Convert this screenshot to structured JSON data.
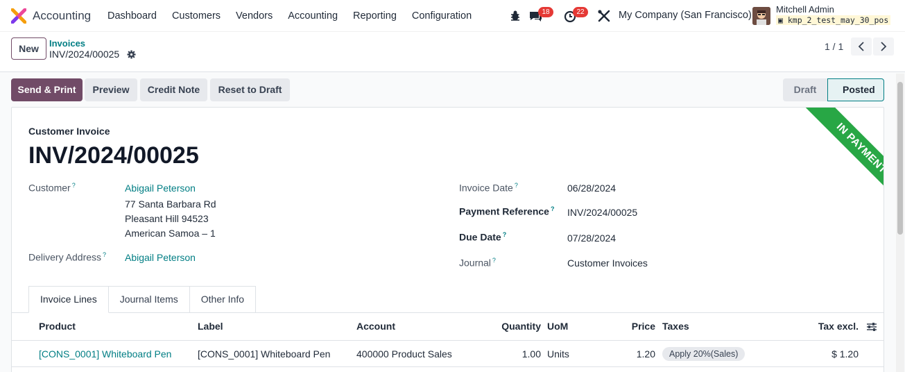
{
  "navbar": {
    "app_name": "Accounting",
    "menu": [
      "Dashboard",
      "Customers",
      "Vendors",
      "Accounting",
      "Reporting",
      "Configuration"
    ],
    "messages_count": "18",
    "activities_count": "22",
    "company": "My Company (San Francisco)",
    "user_name": "Mitchell Admin",
    "database": "kmp_2_test_may_30_pos"
  },
  "control": {
    "new_label": "New",
    "breadcrumb_parent": "Invoices",
    "breadcrumb_current": "INV/2024/00025",
    "pager": "1 / 1"
  },
  "actions": {
    "send_print": "Send & Print",
    "preview": "Preview",
    "credit_note": "Credit Note",
    "reset_draft": "Reset to Draft"
  },
  "status": {
    "draft": "Draft",
    "posted": "Posted"
  },
  "sheet": {
    "ribbon": "IN PAYMENT",
    "type": "Customer Invoice",
    "number": "INV/2024/00025",
    "customer_label": "Customer",
    "customer_name": "Abigail Peterson",
    "address_line1": "77 Santa Barbara Rd",
    "address_line2": "Pleasant Hill 94523",
    "address_line3": "American Samoa – 1",
    "delivery_label": "Delivery Address",
    "delivery_value": "Abigail Peterson",
    "invoice_date_label": "Invoice Date",
    "invoice_date": "06/28/2024",
    "payment_ref_label": "Payment Reference",
    "payment_ref": "INV/2024/00025",
    "due_date_label": "Due Date",
    "due_date": "07/28/2024",
    "journal_label": "Journal",
    "journal": "Customer Invoices"
  },
  "tabs": [
    "Invoice Lines",
    "Journal Items",
    "Other Info"
  ],
  "table": {
    "headers": {
      "product": "Product",
      "label": "Label",
      "account": "Account",
      "quantity": "Quantity",
      "uom": "UoM",
      "price": "Price",
      "taxes": "Taxes",
      "tax_excl": "Tax excl."
    },
    "rows": [
      {
        "product": "[CONS_0001] Whiteboard Pen",
        "label": "[CONS_0001] Whiteboard Pen",
        "account": "400000 Product Sales",
        "quantity": "1.00",
        "uom": "Units",
        "price": "1.20",
        "taxes": "Apply 20%(Sales)",
        "tax_excl": "$ 1.20"
      }
    ]
  },
  "help_mark": "?",
  "colors": {
    "brand": "#714b67",
    "link": "#017e84",
    "ribbon": "#28a745",
    "badge": "#e53935"
  }
}
